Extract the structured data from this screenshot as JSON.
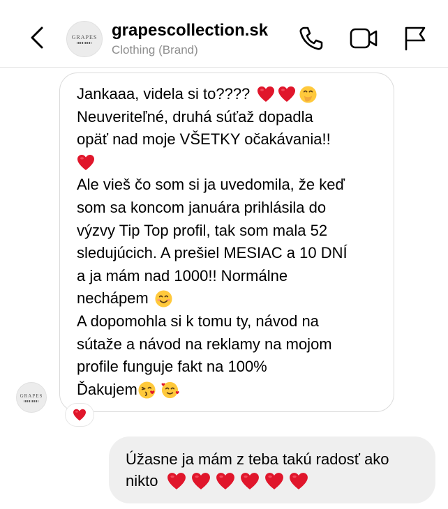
{
  "header": {
    "name": "grapescollection.sk",
    "subtitle": "Clothing (Brand)",
    "avatar_text": "GRAPES",
    "icons": [
      "back-icon",
      "phone-icon",
      "video-icon",
      "flag-icon"
    ]
  },
  "incoming": {
    "avatar_text": "GRAPES",
    "lines": [
      "Jankaaa, videla si to????",
      "Neuveriteľné, druhá súťaž dopadla",
      "opäť nad moje VŠETKY očakávania!!",
      "",
      "Ale vieš čo som si ja uvedomila, že keď",
      "som sa koncom januára prihlásila do",
      "výzvy Tip Top profil, tak som mala 52",
      "sledujúcich. A prešiel MESIAC a 10 DNÍ",
      "a ja mám nad 1000!! Normálne",
      "nechápem",
      "A dopomohla si k tomu ty, návod na",
      "sútaže a návod na reklamy na mojom",
      "profile funguje fakt na 100%",
      "Ďakujem"
    ],
    "reaction": "red-heart"
  },
  "outgoing": {
    "lines": [
      "Úžasne ja mám z teba takú radosť ako",
      "nikto"
    ],
    "heart_count": 6
  },
  "colors": {
    "heart": "#e0162b",
    "border": "#dbdbdb",
    "out_bubble": "#efefef",
    "subtle_text": "#8e8e8e",
    "emoji_face": "#ffc93c"
  }
}
